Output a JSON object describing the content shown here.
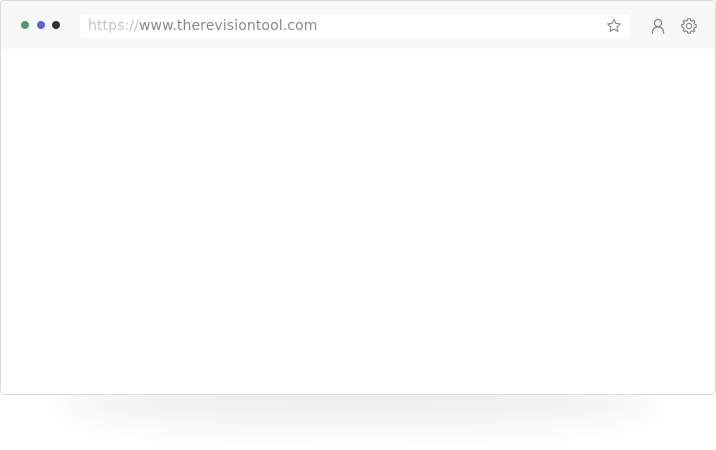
{
  "window": {
    "controls": [
      {
        "name": "green-dot",
        "color": "#4f9a5d"
      },
      {
        "name": "blue-dot",
        "color": "#5865d8"
      },
      {
        "name": "dark-dot",
        "color": "#333333"
      }
    ]
  },
  "address_bar": {
    "protocol": "https://",
    "host": "www.therevisiontool.com"
  },
  "icons": {
    "star": "star-icon",
    "user": "user-icon",
    "settings": "gear-icon"
  },
  "colors": {
    "toolbar_bg": "#f7f7f7",
    "window_border": "#dcdcdc",
    "icon_color": "#8a8a8a"
  }
}
